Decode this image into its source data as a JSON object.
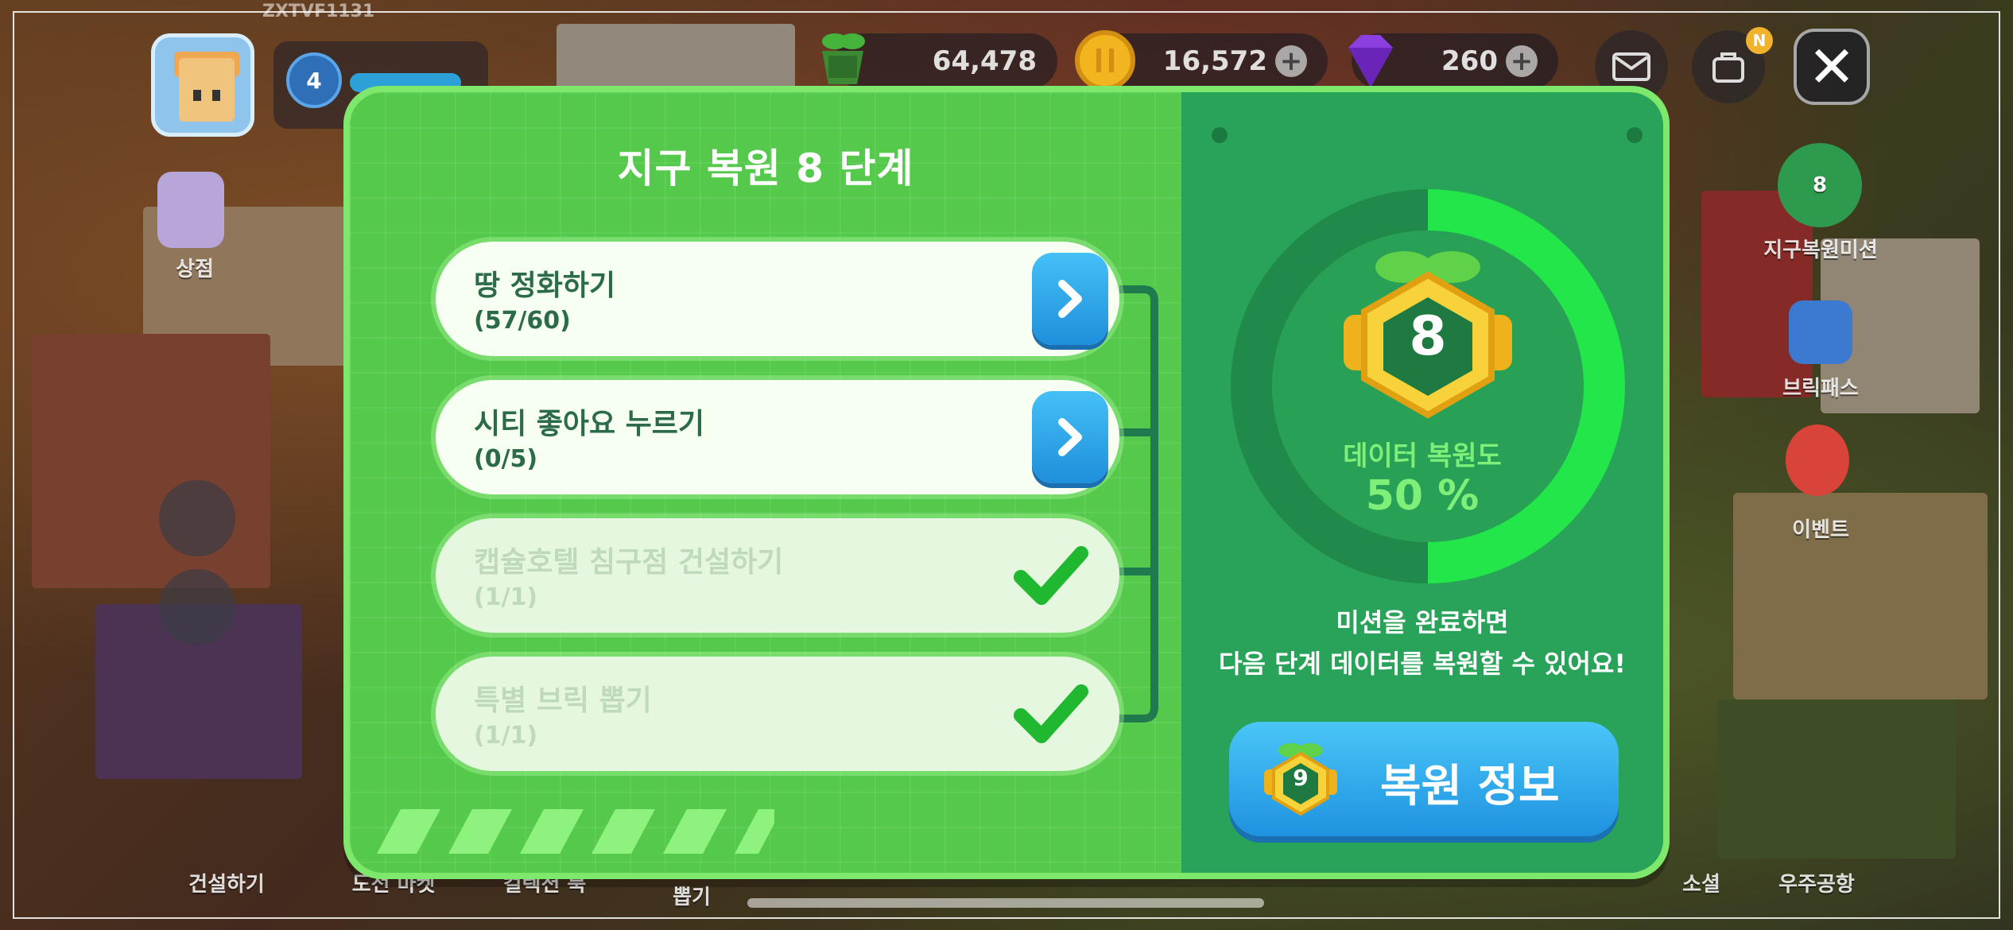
{
  "hud": {
    "user_id": "ZXTVF1131",
    "level": "4",
    "currencies": [
      {
        "name": "energy",
        "value": "64,478",
        "icon": "seedling-fruit-icon",
        "color": "#3fae3a"
      },
      {
        "name": "coin",
        "value": "16,572",
        "icon": "coin-icon",
        "color": "#f2b51f"
      },
      {
        "name": "gem",
        "value": "260",
        "icon": "gem-icon",
        "color": "#8b3fe0"
      }
    ],
    "plus_label": "+",
    "close_label": "✕",
    "badge_letter": "N"
  },
  "side_menu": {
    "shop": "상점",
    "earth_mission": "지구복원미션",
    "earth_mission_level": "8",
    "brick_pass": "브릭패스",
    "event": "이벤트",
    "build": "건설하기",
    "challenge_market": "도전 마켓",
    "collection": "컬렉션 북",
    "draw": "뽑기",
    "social": "소셜",
    "spaceport": "우주공항"
  },
  "modal": {
    "title": "지구 복원 8 단계",
    "missions": [
      {
        "name": "땅 정화하기",
        "progress": "(57/60)",
        "completed": false
      },
      {
        "name": "시티 좋아요 누르기",
        "progress": "(0/5)",
        "completed": false
      },
      {
        "name": "캡슐호텔 침구점 건설하기",
        "progress": "(1/1)",
        "completed": true
      },
      {
        "name": "특별 브릭 뽑기",
        "progress": "(1/1)",
        "completed": true
      }
    ],
    "current_level": "8",
    "rate_label": "데이터 복원도",
    "rate_value": "50 %",
    "rate_fraction": 0.5,
    "description_line1": "미션을 완료하면",
    "description_line2": "다음 단계 데이터를 복원할 수 있어요!",
    "restore_button": {
      "label": "복원 정보",
      "badge_level": "9"
    }
  },
  "colors": {
    "panel_green": "#54c94c",
    "panel_dark": "#2aa35a",
    "progress_green": "#22e64a",
    "button_blue": "#1f92e0"
  }
}
